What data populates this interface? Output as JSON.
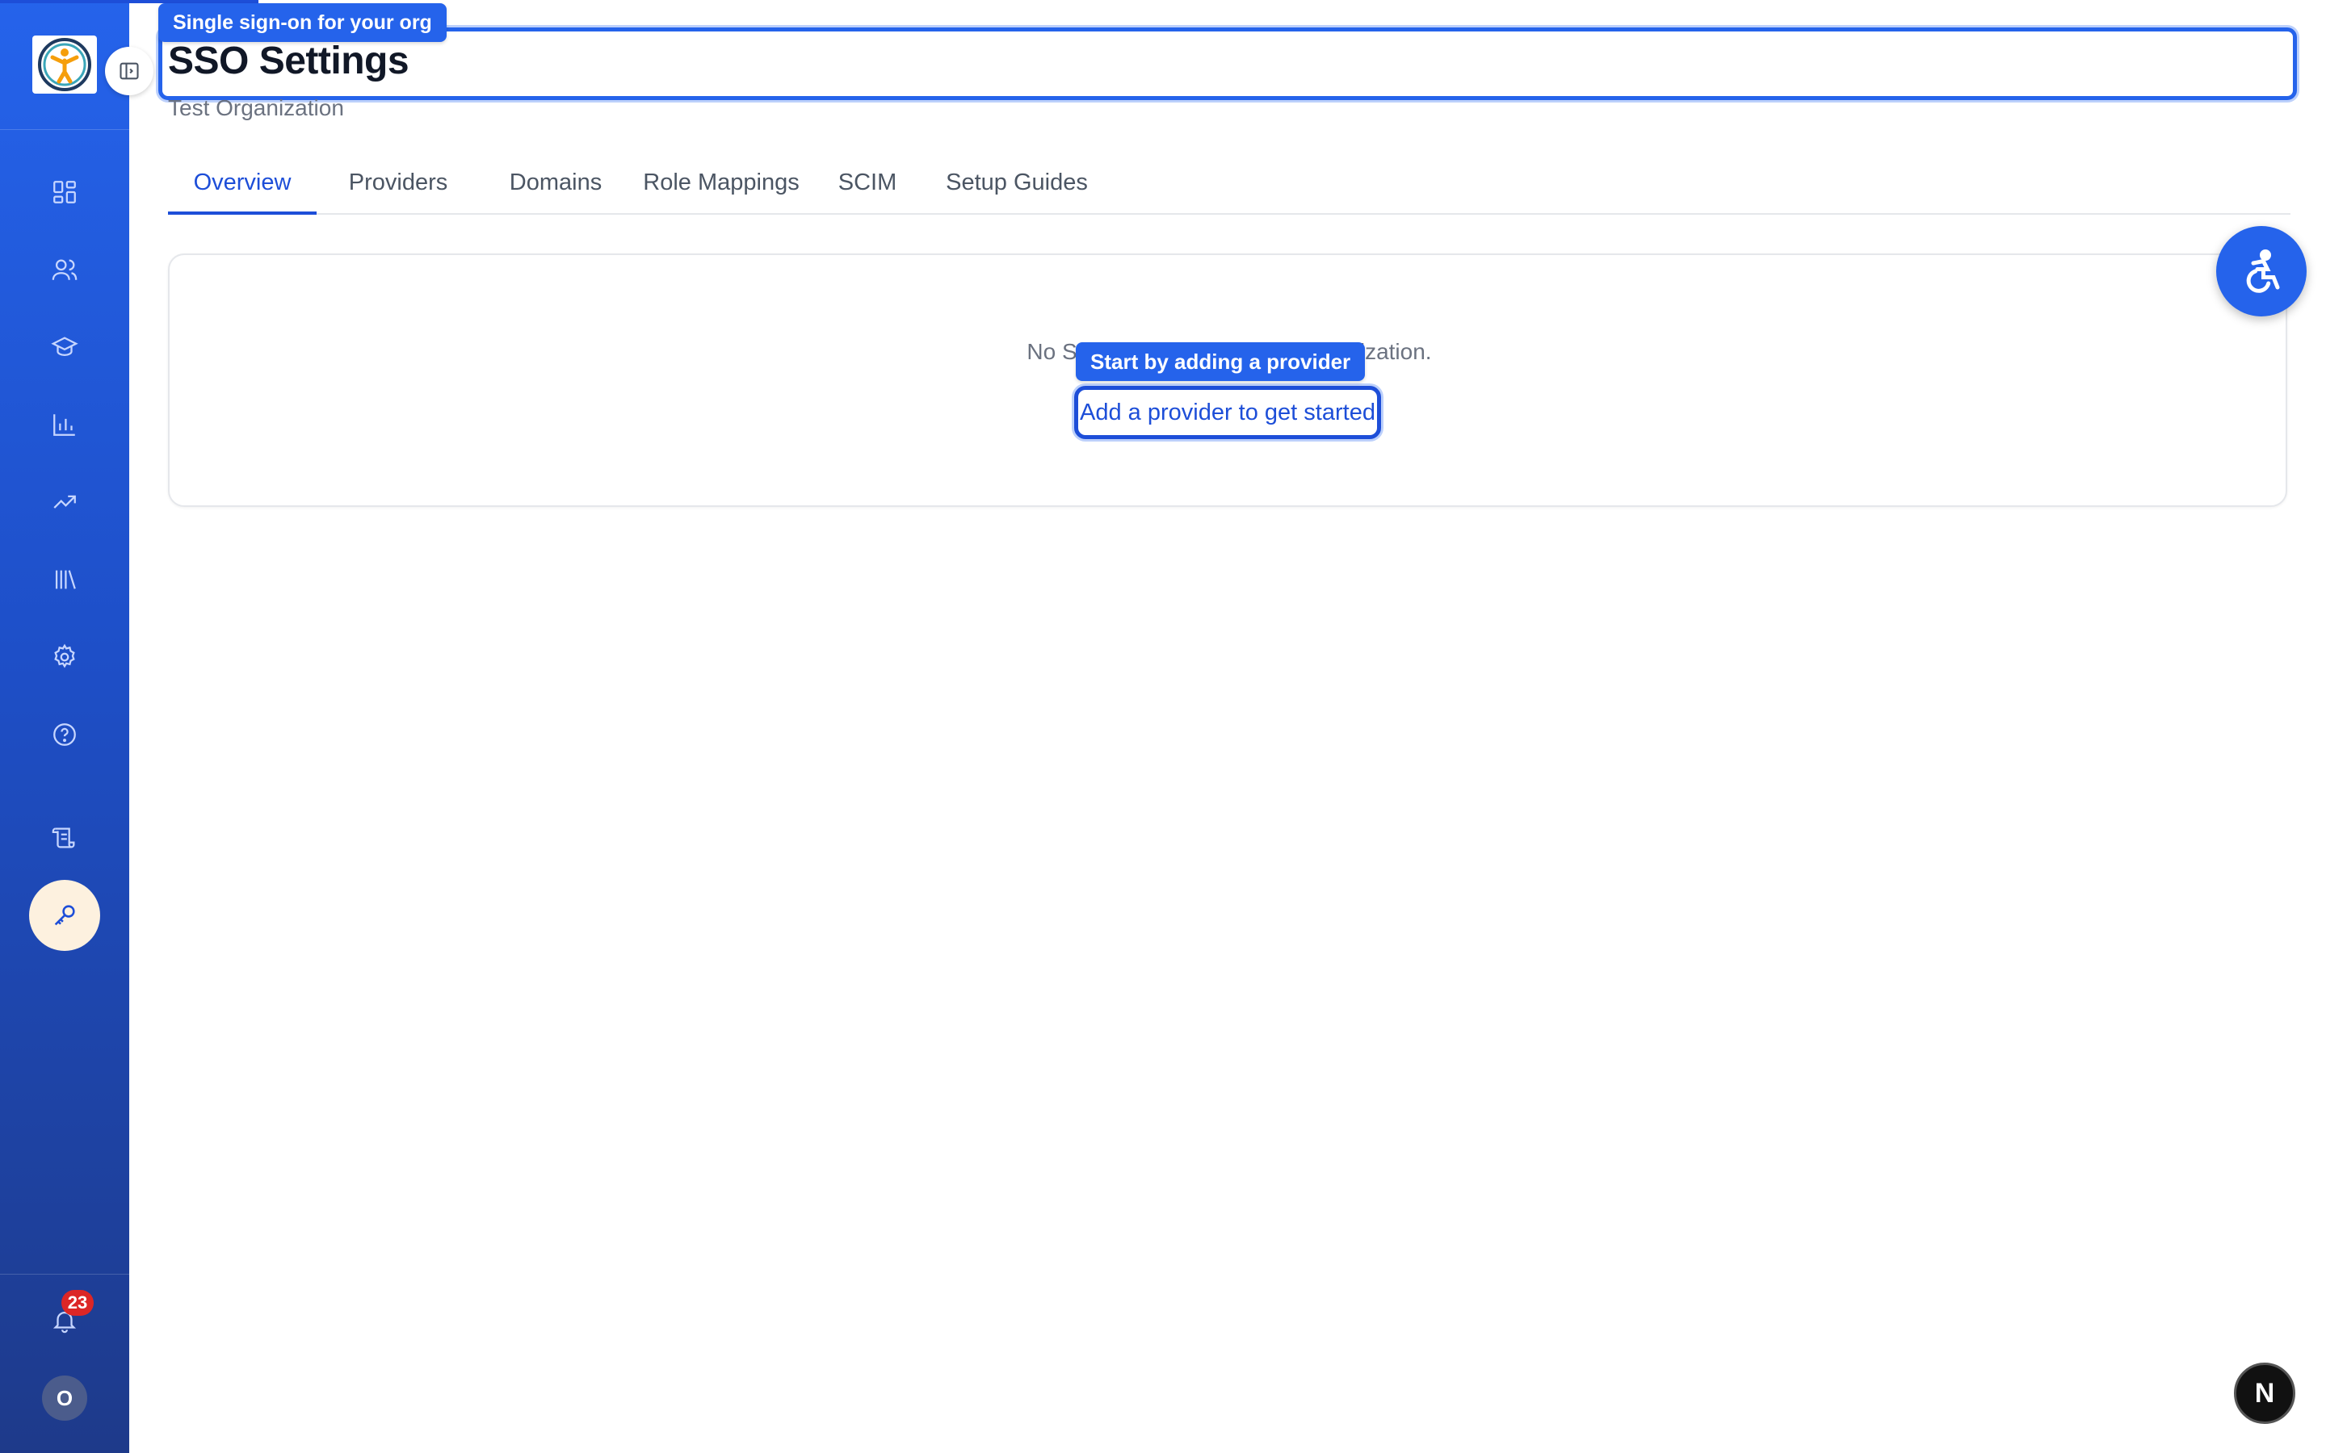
{
  "header": {
    "title": "SSO Settings",
    "subtitle": "Test Organization",
    "title_tooltip": "Single sign-on for your org"
  },
  "tabs": [
    {
      "label": "Overview",
      "active": true
    },
    {
      "label": "Providers",
      "active": false
    },
    {
      "label": "Domains",
      "active": false
    },
    {
      "label": "Role Mappings",
      "active": false
    },
    {
      "label": "SCIM",
      "active": false
    },
    {
      "label": "Setup Guides",
      "active": false
    }
  ],
  "empty_state": {
    "message": "No SSO configured for this organization.",
    "tooltip": "Start by adding a provider",
    "link_label": "Add a provider to get started"
  },
  "sidebar": {
    "items": [
      {
        "icon": "dashboard-icon"
      },
      {
        "icon": "users-icon"
      },
      {
        "icon": "graduation-cap-icon"
      },
      {
        "icon": "bar-chart-icon"
      },
      {
        "icon": "trending-up-icon"
      },
      {
        "icon": "library-icon"
      },
      {
        "icon": "gear-icon"
      },
      {
        "icon": "help-circle-icon"
      },
      {
        "icon": "scroll-icon"
      },
      {
        "icon": "key-icon",
        "active": true
      }
    ],
    "notification_count": "23",
    "avatar_initial": "O"
  },
  "floating": {
    "next_initial": "N"
  },
  "colors": {
    "accent": "#2563eb",
    "active_nav_bg": "#fdf1df",
    "badge": "#dc2626"
  }
}
